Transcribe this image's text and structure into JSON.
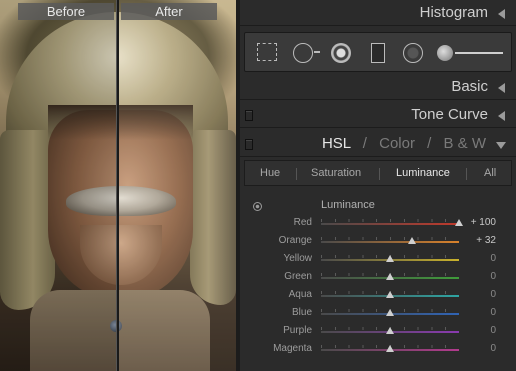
{
  "photo": {
    "before_label": "Before",
    "after_label": "After"
  },
  "panel": {
    "histogram": "Histogram",
    "basic": "Basic",
    "tone_curve": "Tone Curve",
    "hsl_header": {
      "hsl": "HSL",
      "sep1": "/",
      "color": "Color",
      "sep2": "/",
      "bw": "B & W"
    }
  },
  "tools": [
    "crop-overlay",
    "spot-removal",
    "red-eye-correction",
    "graduated-filter",
    "radial-filter",
    "adjustment-brush"
  ],
  "subtabs": [
    "Hue",
    "Saturation",
    "Luminance",
    "All"
  ],
  "selected_subtab": "Luminance",
  "luminance": {
    "title": "Luminance",
    "sliders": [
      {
        "label": "Red",
        "value": "+ 100",
        "amount": 100,
        "color": "#c0392b"
      },
      {
        "label": "Orange",
        "value": "+ 32",
        "amount": 32,
        "color": "#d9822b"
      },
      {
        "label": "Yellow",
        "value": "0",
        "amount": 0,
        "color": "#c9b22c"
      },
      {
        "label": "Green",
        "value": "0",
        "amount": 0,
        "color": "#3f9b3a"
      },
      {
        "label": "Aqua",
        "value": "0",
        "amount": 0,
        "color": "#2ea5a3"
      },
      {
        "label": "Blue",
        "value": "0",
        "amount": 0,
        "color": "#2f63b4"
      },
      {
        "label": "Purple",
        "value": "0",
        "amount": 0,
        "color": "#8a3ab0"
      },
      {
        "label": "Magenta",
        "value": "0",
        "amount": 0,
        "color": "#b23a8d"
      }
    ]
  }
}
